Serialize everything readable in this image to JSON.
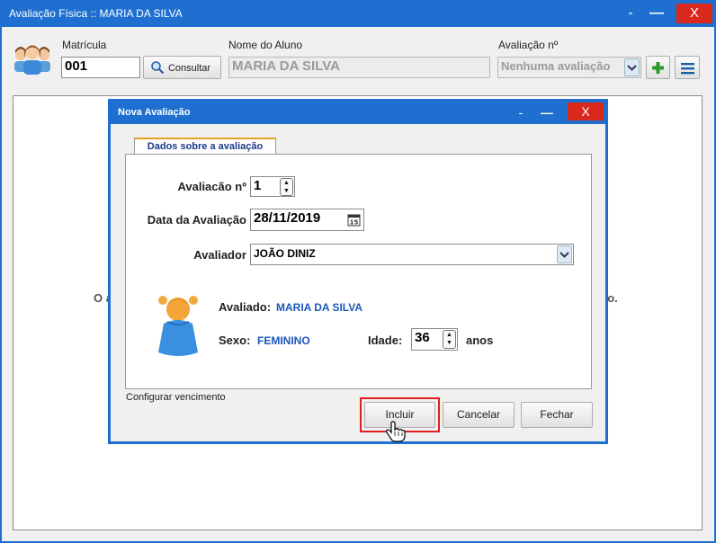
{
  "window": {
    "title": "Avaliação Física  ::  MARIA DA SILVA",
    "minimize": "-",
    "maximize": "—",
    "close": "X"
  },
  "header": {
    "matricula_label": "Matrícula",
    "matricula_value": "001",
    "consultar_label": "Consultar",
    "nome_label": "Nome do Aluno",
    "nome_value": "MARIA DA SILVA",
    "avaliacao_label": "Avaliação nº",
    "avaliacao_value": "Nenhuma avaliação"
  },
  "background_message": {
    "left_fragment": "O a",
    "right_fragment": "ão."
  },
  "dialog": {
    "title": "Nova Avaliação",
    "minimize": "-",
    "maximize": "—",
    "close": "X",
    "tab_label": "Dados sobre a avaliação",
    "fields": {
      "avaliacao_no_label": "Avaliacão nº",
      "avaliacao_no_value": "1",
      "data_label": "Data da Avaliação",
      "data_value": "28/11/2019",
      "avaliador_label": "Avaliador",
      "avaliador_value": "JOÃO DINIZ"
    },
    "avaliado_label": "Avaliado:",
    "avaliado_value": "MARIA DA SILVA",
    "sexo_label": "Sexo:",
    "sexo_value": "FEMININO",
    "idade_label": "Idade:",
    "idade_value": "36",
    "anos_label": "anos",
    "configurar_link": "Configurar vencimento",
    "buttons": {
      "incluir": "Incluir",
      "cancelar": "Cancelar",
      "fechar": "Fechar"
    },
    "highlight_color": "#e0201e"
  },
  "colors": {
    "titlebar": "#1e6fd0",
    "close_button": "#d9291c",
    "accent_green": "#2a9a2a",
    "link_blue": "#1c58b8"
  }
}
